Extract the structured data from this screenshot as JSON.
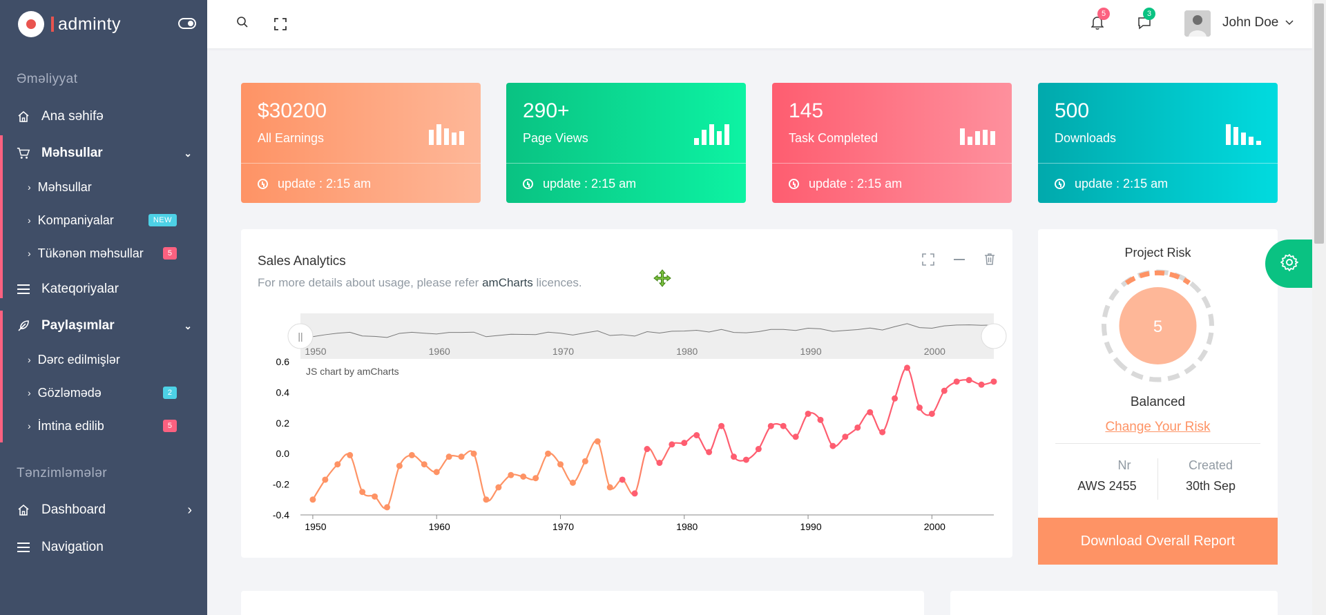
{
  "brand": {
    "name": "adminty"
  },
  "sidebar": {
    "section1": "Əməliyyat",
    "items": [
      {
        "label": "Ana səhifə",
        "icon": "home-icon"
      },
      {
        "label": "Məhsullar",
        "icon": "cart-icon",
        "sub": [
          {
            "label": "Məhsullar"
          },
          {
            "label": "Kompaniyalar",
            "badge": "NEW"
          },
          {
            "label": "Tükənən məhsullar",
            "badge": "5"
          }
        ]
      },
      {
        "label": "Kateqoriyalar",
        "icon": "menu-icon"
      },
      {
        "label": "Paylaşımlar",
        "icon": "feather-icon",
        "sub": [
          {
            "label": "Dərc edilmişlər"
          },
          {
            "label": "Gözləmədə",
            "badge": "2"
          },
          {
            "label": "İmtina edilib",
            "badge": "5"
          }
        ]
      }
    ],
    "section2": "Tənzimləmələr",
    "items2": [
      {
        "label": "Dashboard",
        "icon": "home-icon"
      },
      {
        "label": "Navigation",
        "icon": "menu-icon"
      }
    ]
  },
  "topbar": {
    "notifications": "5",
    "messages": "3",
    "user": "John Doe"
  },
  "cards": [
    {
      "value": "$30200",
      "label": "All Earnings",
      "update": "update : 2:15 am",
      "from": "#fe9365",
      "to": "#feb798"
    },
    {
      "value": "290+",
      "label": "Page Views",
      "update": "update : 2:15 am",
      "from": "#0ac282",
      "to": "#0df3a3"
    },
    {
      "value": "145",
      "label": "Task Completed",
      "update": "update : 2:15 am",
      "from": "#fe5d70",
      "to": "#fe909d"
    },
    {
      "value": "500",
      "label": "Downloads",
      "update": "update : 2:15 am",
      "from": "#01a9ac",
      "to": "#01dbdf"
    }
  ],
  "analytics": {
    "title": "Sales Analytics",
    "subtitle_pre": "For more details about usage, please refer ",
    "subtitle_link": "amCharts",
    "subtitle_post": " licences.",
    "credit": "JS chart by amCharts"
  },
  "chart_data": {
    "type": "line",
    "title": "Sales Analytics",
    "xlabel": "",
    "ylabel": "",
    "xlim": [
      1949,
      2005
    ],
    "ylim": [
      -0.4,
      0.6
    ],
    "x_ticks": [
      1950,
      1960,
      1970,
      1980,
      1990,
      2000
    ],
    "y_ticks": [
      "0.6",
      "0.4",
      "0.2",
      "0.0",
      "-0.2",
      "-0.4"
    ],
    "color_start": "#fe9365",
    "color_end": "#fe5d70",
    "x": [
      1950,
      1951,
      1952,
      1953,
      1954,
      1955,
      1956,
      1957,
      1958,
      1959,
      1960,
      1961,
      1962,
      1963,
      1964,
      1965,
      1966,
      1967,
      1968,
      1969,
      1970,
      1971,
      1972,
      1973,
      1974,
      1975,
      1976,
      1977,
      1978,
      1979,
      1980,
      1981,
      1982,
      1983,
      1984,
      1985,
      1986,
      1987,
      1988,
      1989,
      1990,
      1991,
      1992,
      1993,
      1994,
      1995,
      1996,
      1997,
      1998,
      1999,
      2000,
      2001,
      2002,
      2003,
      2004,
      2005
    ],
    "values": [
      -0.3,
      -0.17,
      -0.07,
      -0.01,
      -0.25,
      -0.28,
      -0.35,
      -0.08,
      -0.01,
      -0.07,
      -0.12,
      -0.02,
      -0.02,
      0.0,
      -0.3,
      -0.22,
      -0.14,
      -0.15,
      -0.16,
      0.0,
      -0.07,
      -0.19,
      -0.05,
      0.08,
      -0.22,
      -0.17,
      -0.26,
      0.03,
      -0.06,
      0.06,
      0.07,
      0.12,
      0.01,
      0.18,
      -0.02,
      -0.04,
      0.03,
      0.18,
      0.18,
      0.11,
      0.26,
      0.22,
      0.05,
      0.11,
      0.17,
      0.27,
      0.14,
      0.36,
      0.56,
      0.3,
      0.26,
      0.41,
      0.47,
      0.48,
      0.45,
      0.47
    ]
  },
  "risk": {
    "title": "Project Risk",
    "score": "5",
    "status": "Balanced",
    "link": "Change Your Risk",
    "nr_label": "Nr",
    "nr_value": "AWS 2455",
    "created_label": "Created",
    "created_value": "30th Sep",
    "button": "Download Overall Report"
  }
}
